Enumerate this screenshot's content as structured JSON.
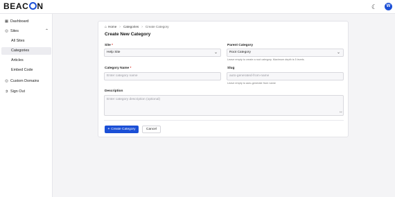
{
  "header": {
    "logo_prefix": "BEAC",
    "logo_suffix": "N",
    "theme_icon": "moon-icon",
    "avatar_initial": "W",
    "accent": "#1b4fd6"
  },
  "sidebar": {
    "items": [
      {
        "label": "Dashboard",
        "icon": "grid-icon"
      },
      {
        "label": "Sites",
        "icon": "globe-icon"
      },
      {
        "label": "All Sites"
      },
      {
        "label": "Categories"
      },
      {
        "label": "Articles"
      },
      {
        "label": "Embed Code"
      },
      {
        "label": "Custom Domains",
        "icon": "globe-icon"
      },
      {
        "label": "Sign Out",
        "icon": "logout-icon"
      }
    ]
  },
  "breadcrumb": {
    "home": "Home",
    "categories": "Categories",
    "current": "Create Category"
  },
  "form": {
    "title": "Create New Category",
    "site": {
      "label": "Site",
      "required": "*",
      "value": "Help Site"
    },
    "parent": {
      "label": "Parent Category",
      "value": "Root Category",
      "help": "Leave empty to create a root category. Maximum depth is 5 levels."
    },
    "name": {
      "label": "Category Name",
      "required": "*",
      "placeholder": "Enter category name"
    },
    "slug": {
      "label": "Slug",
      "placeholder": "auto-generated-from-name",
      "help": "Leave empty to auto-generate from name"
    },
    "description": {
      "label": "Description",
      "placeholder": "Enter category description (optional)"
    },
    "submit_label": "Create Category",
    "cancel_label": "Cancel"
  }
}
